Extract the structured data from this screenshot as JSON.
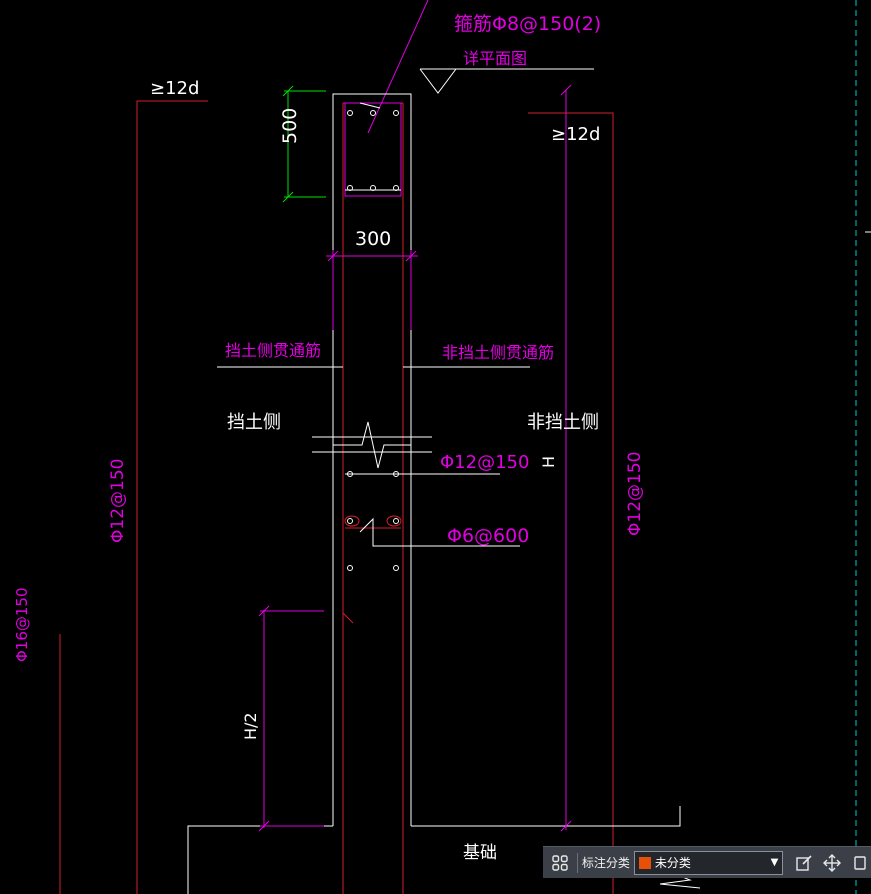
{
  "drawing": {
    "stirrup_note": "箍筋Φ8@150(2)",
    "detail_ref": "详平面图",
    "anchor_left": "≥12d",
    "anchor_right": "≥12d",
    "dim_500": "500",
    "dim_300": "300",
    "soil_side_bar": "挡土侧贯通筋",
    "nonsoil_side_bar": "非挡土侧贯通筋",
    "soil_side": "挡土侧",
    "nonsoil_side": "非挡土侧",
    "horiz_bar": "Φ12@150",
    "tie_bar": "Φ6@600",
    "h_label": "H",
    "half_h": "H/2",
    "left_vert_bar": "Φ12@150",
    "right_vert_bar": "Φ12@150",
    "far_left_bar": "Φ16@150",
    "foundation": "基础"
  },
  "toolbar": {
    "label": "标注分类",
    "selected": "未分类",
    "swatch_color": "#e8500a"
  },
  "colors": {
    "background": "#000000",
    "magenta": "#e000e0",
    "red": "#d0202a",
    "green": "#00e000",
    "white": "#ffffff",
    "cyan": "#00c8c8"
  }
}
